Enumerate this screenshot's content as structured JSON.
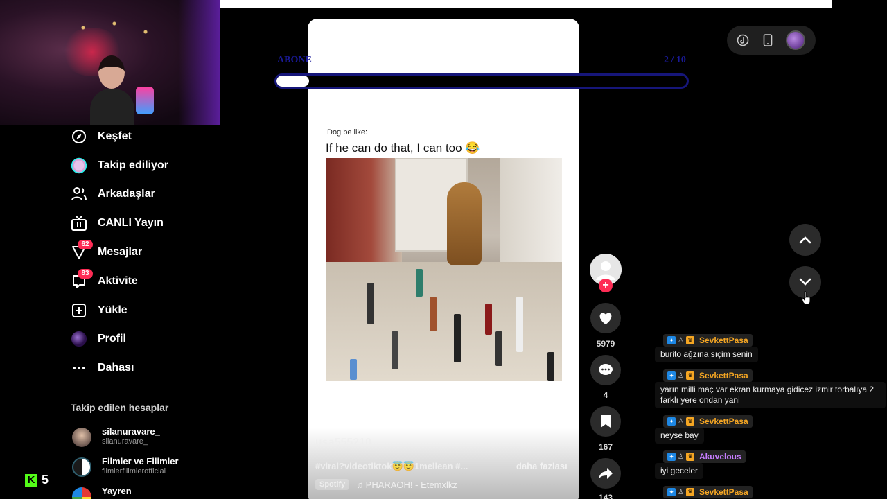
{
  "nav": {
    "items": [
      {
        "label": "Keşfet",
        "icon": "compass-icon"
      },
      {
        "label": "Takip ediliyor",
        "icon": "following-avatar-icon"
      },
      {
        "label": "Arkadaşlar",
        "icon": "friends-icon"
      },
      {
        "label": "CANLI Yayın",
        "icon": "live-tv-icon"
      },
      {
        "label": "Mesajlar",
        "icon": "messages-icon",
        "badge": "62"
      },
      {
        "label": "Aktivite",
        "icon": "activity-icon",
        "badge": "83"
      },
      {
        "label": "Yükle",
        "icon": "upload-plus-icon"
      },
      {
        "label": "Profil",
        "icon": "profile-avatar-icon"
      },
      {
        "label": "Dahası",
        "icon": "more-dots-icon"
      }
    ]
  },
  "following": {
    "title": "Takip edilen hesaplar",
    "accounts": [
      {
        "name": "silanuravare_",
        "handle": "silanuravare_"
      },
      {
        "name": "Filmler ve Filimler",
        "handle": "filmlerfilimlerofficial"
      },
      {
        "name": "Yayren",
        "handle": ""
      }
    ]
  },
  "kick": {
    "count": "5"
  },
  "overlay": {
    "abone_label": "ABONE",
    "count": "2 / 10",
    "progress_fraction": 0.08
  },
  "video": {
    "caption_small": "Dog be like:",
    "caption_big": "If he can do that, I can too 😂",
    "username": "usa555210",
    "tags": "#viral?videotiktok😇😇1mellean #...",
    "more_label": "daha fazlası",
    "music_source": "Spotify",
    "song": "♫  PHARAOH! - Etemxlkz"
  },
  "actions": {
    "likes": "5979",
    "comments": "4",
    "saves": "167",
    "shares": "143"
  },
  "chat": {
    "messages": [
      {
        "user": "SevkettPasa",
        "color": "#f5a623",
        "text": "burito ağzına sıçim senin"
      },
      {
        "user": "SevkettPasa",
        "color": "#f5a623",
        "text": "yarın milli maç var ekran kurmaya gidicez izmir torbalıya 2 farklı yere ondan yani"
      },
      {
        "user": "SevkettPasa",
        "color": "#f5a623",
        "text": "neyse bay"
      },
      {
        "user": "Akuvelous",
        "color": "#c77dff",
        "text": "iyi geceler"
      },
      {
        "user": "SevkettPasa",
        "color": "#f5a623",
        "text": ""
      }
    ]
  },
  "colors": {
    "accent": "#fe2c55",
    "kick": "#53fc18",
    "overlay_blue": "#1a1a99"
  }
}
